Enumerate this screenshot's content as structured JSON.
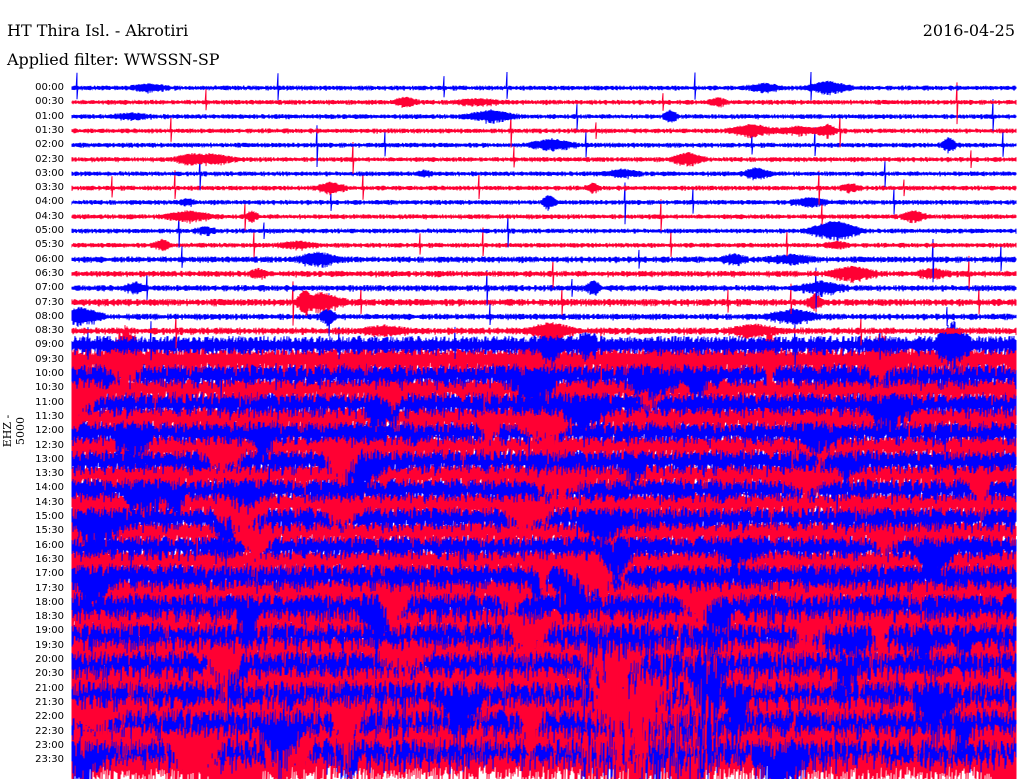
{
  "header": {
    "title": "HT Thira Isl. - Akrotiri",
    "date": "2016-04-25",
    "filter": "Applied filter: WWSSN-SP"
  },
  "colors": {
    "even": "#0000ff",
    "odd": "#ff0033"
  },
  "chart_data": {
    "type": "line",
    "title": "HT Thira Isl. - Akrotiri",
    "ylabel": "EHZ - 5000",
    "row_labels": [
      "00:00",
      "00:30",
      "01:00",
      "01:30",
      "02:00",
      "02:30",
      "03:00",
      "03:30",
      "04:00",
      "04:30",
      "05:00",
      "05:30",
      "06:00",
      "06:30",
      "07:00",
      "07:30",
      "08:00",
      "08:30",
      "09:00",
      "09:30",
      "10:00",
      "10:30",
      "11:00",
      "11:30",
      "12:00",
      "12:30",
      "13:00",
      "13:30",
      "14:00",
      "14:30",
      "15:00",
      "15:30",
      "16:00",
      "16:30",
      "17:00",
      "17:30",
      "18:00",
      "18:30",
      "19:00",
      "19:30",
      "20:00",
      "20:30",
      "21:00",
      "21:30",
      "22:00",
      "22:30",
      "23:00",
      "23:30"
    ],
    "relative_amplitude": [
      1,
      1,
      1,
      1,
      1,
      1,
      1,
      1,
      1,
      1,
      1,
      1,
      1.3,
      1.3,
      1.3,
      1.5,
      1.3,
      1.5,
      4,
      6,
      6,
      6,
      6,
      6,
      6,
      6,
      6,
      6,
      6,
      6,
      6,
      6,
      6,
      6,
      7,
      7,
      8,
      8,
      8,
      8,
      8,
      9,
      9,
      9,
      9,
      10,
      10,
      11
    ]
  }
}
